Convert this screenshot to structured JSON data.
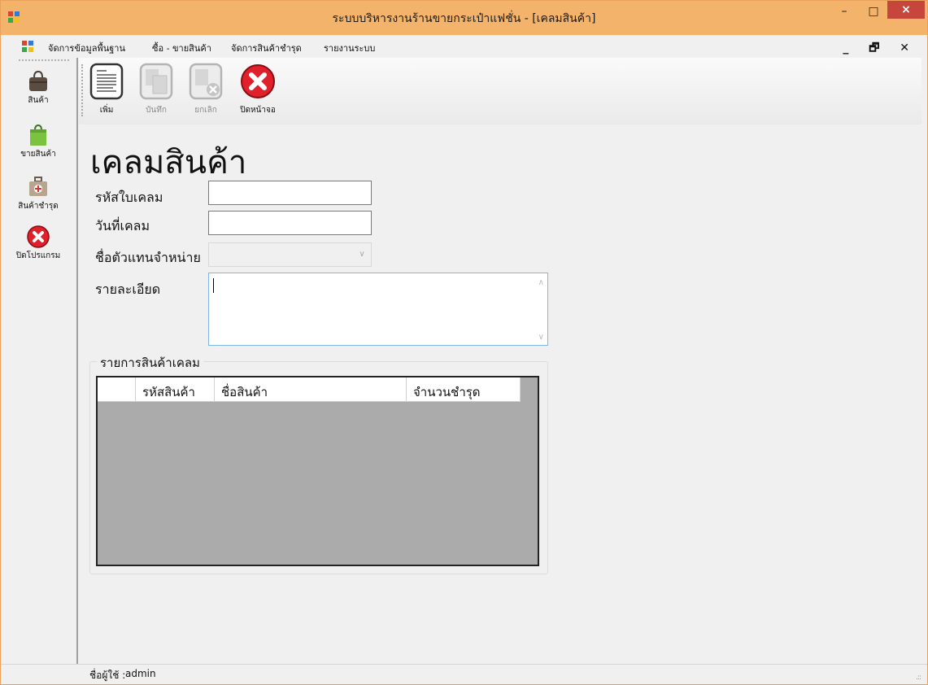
{
  "titlebar": {
    "title": "ระบบบริหารงานร้านขายกระเป๋าแฟชั่น - [เคลมสินค้า]",
    "app_icon": "app-window-icon",
    "minimize": "–",
    "maximize": "□",
    "close": "×"
  },
  "menubar": {
    "items": [
      {
        "label": "จัดการข้อมูลพื้นฐาน"
      },
      {
        "label": "ซื้อ - ขายสินค้า"
      },
      {
        "label": "จัดการสินค้าชำรุด"
      },
      {
        "label": "รายงานระบบ"
      }
    ],
    "mdi_controls": "_ 🗗 ✕"
  },
  "sidebar": {
    "items": [
      {
        "label": "สินค้า",
        "icon": "handbag-icon"
      },
      {
        "label": "ขายสินค้า",
        "icon": "shopping-bag-icon"
      },
      {
        "label": "สินค้าชำรุด",
        "icon": "first-aid-kit-icon"
      },
      {
        "label": "ปิดโปรแกรม",
        "icon": "close-circle-icon"
      }
    ]
  },
  "toolbar": {
    "buttons": [
      {
        "label": "เพิ่ม",
        "icon": "new-document-icon",
        "enabled": true
      },
      {
        "label": "บันทึก",
        "icon": "save-document-icon",
        "enabled": false
      },
      {
        "label": "ยกเลิก",
        "icon": "cancel-document-icon",
        "enabled": false
      },
      {
        "label": "ปิดหน้าจอ",
        "icon": "close-circle-icon",
        "enabled": true
      }
    ]
  },
  "form": {
    "heading": "เคลมสินค้า",
    "claim_id_label": "รหัสใบเคลม",
    "claim_id_value": "",
    "claim_date_label": "วันที่เคลม",
    "claim_date_value": "",
    "dealer_label": "ชื่อตัวแทนจำหน่าย",
    "dealer_value": "",
    "detail_label": "รายละเอียด",
    "detail_value": ""
  },
  "claim_items": {
    "group_title": "รายการสินค้าเคลม",
    "columns": [
      "",
      "รหัสสินค้า",
      "ชื่อสินค้า",
      "จำนวนชำรุด"
    ],
    "rows": []
  },
  "statusbar": {
    "user_label": "ชื่อผู้ใช้ :",
    "user_value": "admin"
  },
  "colors": {
    "titlebar": "#f3b36b",
    "close_button": "#c7463c",
    "grid_background": "#ababab",
    "textarea_focus_border": "#7eb4ea"
  }
}
